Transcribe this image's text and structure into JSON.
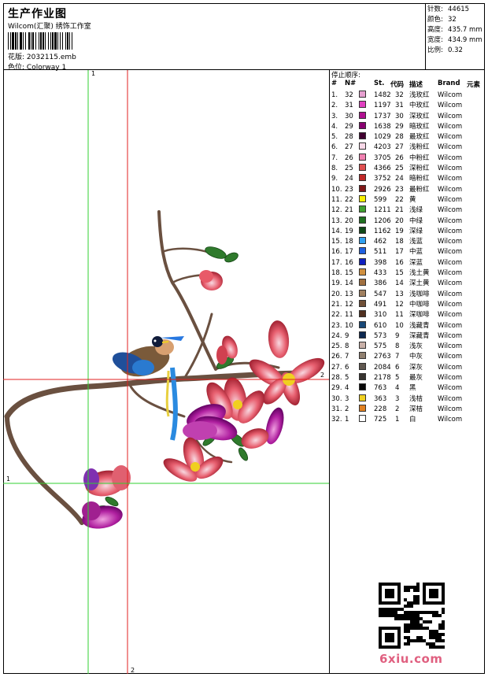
{
  "header": {
    "title": "生产作业图",
    "company": "Wilcom(汇聚) 绣饰工作室",
    "file_label": "花版:",
    "file_name": "2032115.emb",
    "colorway_label": "色位:",
    "colorway_name": "Colorway 1"
  },
  "stats": [
    {
      "label": "针数:",
      "value": "44615"
    },
    {
      "label": "颜色:",
      "value": "32"
    },
    {
      "label": "高度:",
      "value": "435.7 mm"
    },
    {
      "label": "宽度:",
      "value": "434.9 mm"
    },
    {
      "label": "比例:",
      "value": "0.32"
    }
  ],
  "table": {
    "title": "停止顺序:",
    "columns": {
      "num": "#",
      "n": "N#",
      "st": "St.",
      "code": "代码",
      "desc": "描述",
      "brand": "Brand",
      "elem": "元素"
    },
    "rows": [
      {
        "num": "1.",
        "n": "32",
        "color": "#e6a0d0",
        "st": "1482",
        "code": "32",
        "desc": "浅玫红",
        "brand": "Wilcom"
      },
      {
        "num": "2.",
        "n": "31",
        "color": "#e040c0",
        "st": "1197",
        "code": "31",
        "desc": "中玫红",
        "brand": "Wilcom"
      },
      {
        "num": "3.",
        "n": "30",
        "color": "#b01090",
        "st": "1737",
        "code": "30",
        "desc": "深玫红",
        "brand": "Wilcom"
      },
      {
        "num": "4.",
        "n": "29",
        "color": "#880070",
        "st": "1638",
        "code": "29",
        "desc": "暗玫红",
        "brand": "Wilcom"
      },
      {
        "num": "5.",
        "n": "28",
        "color": "#400030",
        "st": "1029",
        "code": "28",
        "desc": "最玫红",
        "brand": "Wilcom"
      },
      {
        "num": "6.",
        "n": "27",
        "color": "#f8d8e8",
        "st": "4203",
        "code": "27",
        "desc": "浅粉红",
        "brand": "Wilcom"
      },
      {
        "num": "7.",
        "n": "26",
        "color": "#f080b0",
        "st": "3705",
        "code": "26",
        "desc": "中粉红",
        "brand": "Wilcom"
      },
      {
        "num": "8.",
        "n": "25",
        "color": "#e05050",
        "st": "4366",
        "code": "25",
        "desc": "深粉红",
        "brand": "Wilcom"
      },
      {
        "num": "9.",
        "n": "24",
        "color": "#c02828",
        "st": "3752",
        "code": "24",
        "desc": "暗粉红",
        "brand": "Wilcom"
      },
      {
        "num": "10.",
        "n": "23",
        "color": "#801818",
        "st": "2926",
        "code": "23",
        "desc": "最粉红",
        "brand": "Wilcom"
      },
      {
        "num": "11.",
        "n": "22",
        "color": "#f8f000",
        "st": "599",
        "code": "22",
        "desc": "黄",
        "brand": "Wilcom"
      },
      {
        "num": "12.",
        "n": "21",
        "color": "#40a030",
        "st": "1211",
        "code": "21",
        "desc": "浅绿",
        "brand": "Wilcom"
      },
      {
        "num": "13.",
        "n": "20",
        "color": "#207020",
        "st": "1206",
        "code": "20",
        "desc": "中绿",
        "brand": "Wilcom"
      },
      {
        "num": "14.",
        "n": "19",
        "color": "#104818",
        "st": "1162",
        "code": "19",
        "desc": "深绿",
        "brand": "Wilcom"
      },
      {
        "num": "15.",
        "n": "18",
        "color": "#30a0f0",
        "st": "462",
        "code": "18",
        "desc": "浅蓝",
        "brand": "Wilcom"
      },
      {
        "num": "16.",
        "n": "17",
        "color": "#2060e0",
        "st": "511",
        "code": "17",
        "desc": "中蓝",
        "brand": "Wilcom"
      },
      {
        "num": "17.",
        "n": "16",
        "color": "#1020c0",
        "st": "398",
        "code": "16",
        "desc": "深蓝",
        "brand": "Wilcom"
      },
      {
        "num": "18.",
        "n": "15",
        "color": "#d09040",
        "st": "433",
        "code": "15",
        "desc": "浅土黄",
        "brand": "Wilcom"
      },
      {
        "num": "19.",
        "n": "14",
        "color": "#a07040",
        "st": "386",
        "code": "14",
        "desc": "深土黄",
        "brand": "Wilcom"
      },
      {
        "num": "20.",
        "n": "13",
        "color": "#a08060",
        "st": "547",
        "code": "13",
        "desc": "浅咖啡",
        "brand": "Wilcom"
      },
      {
        "num": "21.",
        "n": "12",
        "color": "#705038",
        "st": "491",
        "code": "12",
        "desc": "中咖啡",
        "brand": "Wilcom"
      },
      {
        "num": "22.",
        "n": "11",
        "color": "#503020",
        "st": "310",
        "code": "11",
        "desc": "深咖啡",
        "brand": "Wilcom"
      },
      {
        "num": "23.",
        "n": "10",
        "color": "#184878",
        "st": "610",
        "code": "10",
        "desc": "浅藏青",
        "brand": "Wilcom"
      },
      {
        "num": "24.",
        "n": "9",
        "color": "#0c2850",
        "st": "573",
        "code": "9",
        "desc": "深藏青",
        "brand": "Wilcom"
      },
      {
        "num": "25.",
        "n": "8",
        "color": "#c8b0a8",
        "st": "575",
        "code": "8",
        "desc": "浅灰",
        "brand": "Wilcom"
      },
      {
        "num": "26.",
        "n": "7",
        "color": "#908070",
        "st": "2763",
        "code": "7",
        "desc": "中灰",
        "brand": "Wilcom"
      },
      {
        "num": "27.",
        "n": "6",
        "color": "#605850",
        "st": "2084",
        "code": "6",
        "desc": "深灰",
        "brand": "Wilcom"
      },
      {
        "num": "28.",
        "n": "5",
        "color": "#383430",
        "st": "2178",
        "code": "5",
        "desc": "最灰",
        "brand": "Wilcom"
      },
      {
        "num": "29.",
        "n": "4",
        "color": "#080808",
        "st": "763",
        "code": "4",
        "desc": "黑",
        "brand": "Wilcom"
      },
      {
        "num": "30.",
        "n": "3",
        "color": "#f0d020",
        "st": "363",
        "code": "3",
        "desc": "浅桔",
        "brand": "Wilcom"
      },
      {
        "num": "31.",
        "n": "2",
        "color": "#e08020",
        "st": "228",
        "code": "2",
        "desc": "深桔",
        "brand": "Wilcom"
      },
      {
        "num": "32.",
        "n": "1",
        "color": "#ffffff",
        "st": "725",
        "code": "1",
        "desc": "白",
        "brand": "Wilcom"
      }
    ]
  },
  "canvas": {
    "axis_labels": {
      "green_v_top": "1",
      "red_v_bottom": "2",
      "red_h_right": "2",
      "green_h_left": "1"
    },
    "guide_colors": {
      "green": "#30d030",
      "red": "#e02020"
    }
  },
  "watermark": "6xiu.com"
}
